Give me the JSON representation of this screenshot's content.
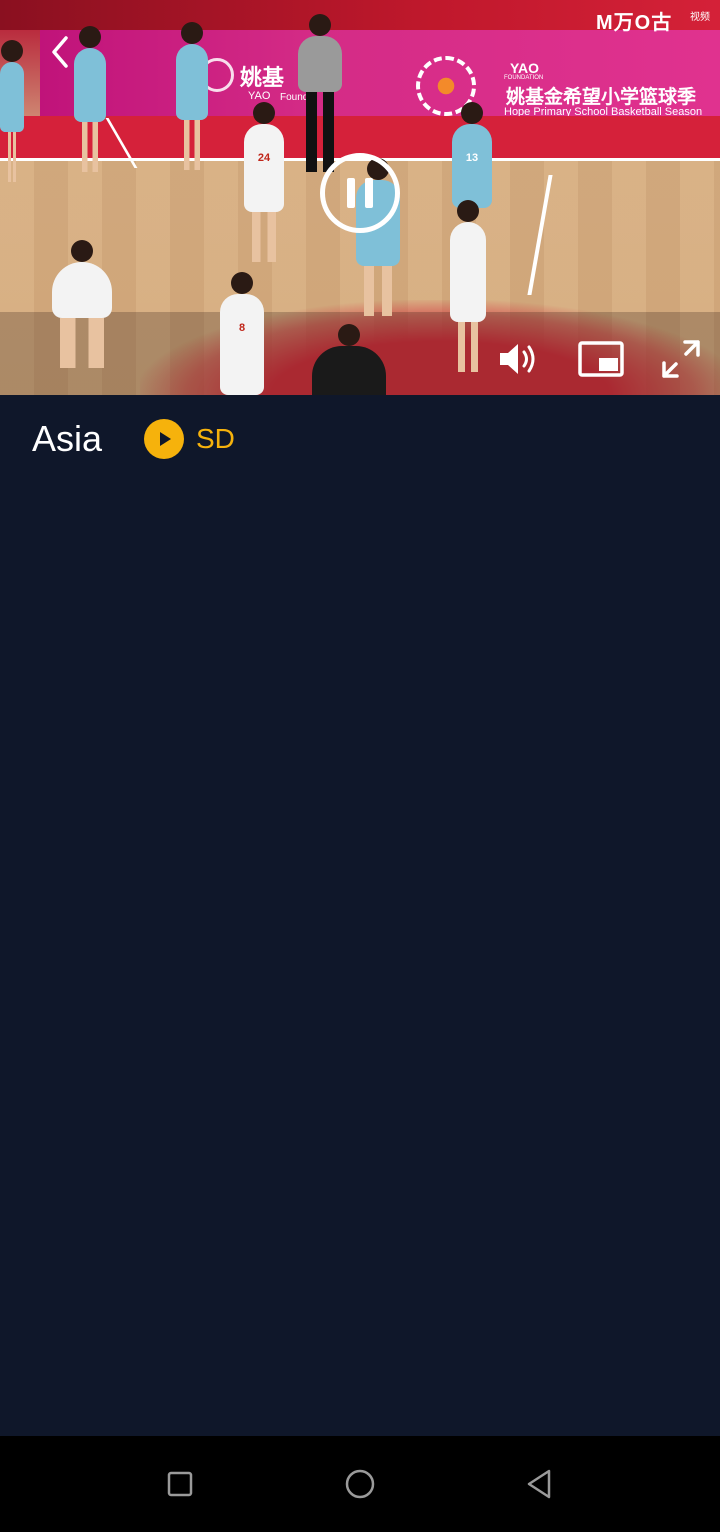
{
  "video": {
    "banner_cn_short": "姚基",
    "banner_yao": "YAO",
    "banner_foundation_short": "Found",
    "banner_yao_foundation": "YAO",
    "banner_foundation_word": "FOUNDATION",
    "banner_cn_title": "姚基金希望小学篮球季",
    "banner_en_title": "Hope Primary School Basketball Season",
    "jersey_numbers": [
      "24",
      "13",
      "8"
    ],
    "watermark": "M万O古",
    "watermark_small": "视频"
  },
  "channel": {
    "title": "Asia",
    "quality_label": "SD"
  },
  "colors": {
    "background": "#0f172a",
    "accent": "#f6b20c",
    "navbar": "#000000"
  },
  "icons": {
    "back": "chevron-left-icon",
    "pause": "pause-icon",
    "volume": "volume-icon",
    "pip": "picture-in-picture-icon",
    "fullscreen": "fullscreen-icon",
    "quality": "play-circle-icon",
    "nav_recent": "square-icon",
    "nav_home": "circle-icon",
    "nav_back": "triangle-back-icon"
  }
}
